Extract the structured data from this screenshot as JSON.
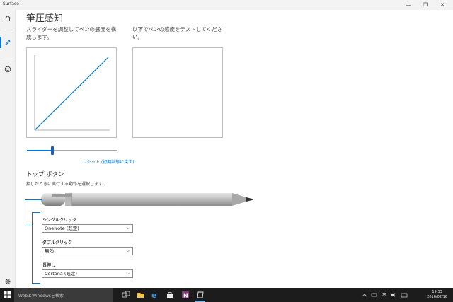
{
  "window": {
    "title": "Surface",
    "minimize_glyph": "—",
    "restore_glyph": "❐",
    "close_glyph": "✕"
  },
  "nav": {
    "items": [
      {
        "icon": "home-icon"
      },
      {
        "icon": "pen-icon",
        "active": true
      },
      {
        "icon": "smiley-icon"
      },
      {
        "icon": "gear-icon"
      }
    ]
  },
  "pressure": {
    "title": "筆圧感知",
    "slider_desc": "スライダーを調整してペンの感度を構成します。",
    "test_desc": "以下でペンの感度をテストしてください。",
    "slider_value": 0.28,
    "reset_label": "リセット (初期状態に戻す)"
  },
  "top_button": {
    "title": "トップ ボタン",
    "desc": "押したときに実行する動作を選択します。",
    "single_click": {
      "label": "シングルクリック",
      "value": "OneNote (既定)"
    },
    "double_click": {
      "label": "ダブルクリック",
      "value": "無効"
    },
    "long_press": {
      "label": "長押し",
      "value": "Cortana (既定)"
    },
    "chevron": "⌵"
  },
  "taskbar": {
    "search_placeholder": "WebとWindowsを検索",
    "time": "19:33",
    "date": "2016/02/16"
  },
  "colors": {
    "accent": "#0078d7",
    "taskbar": "#1c1c1c"
  }
}
